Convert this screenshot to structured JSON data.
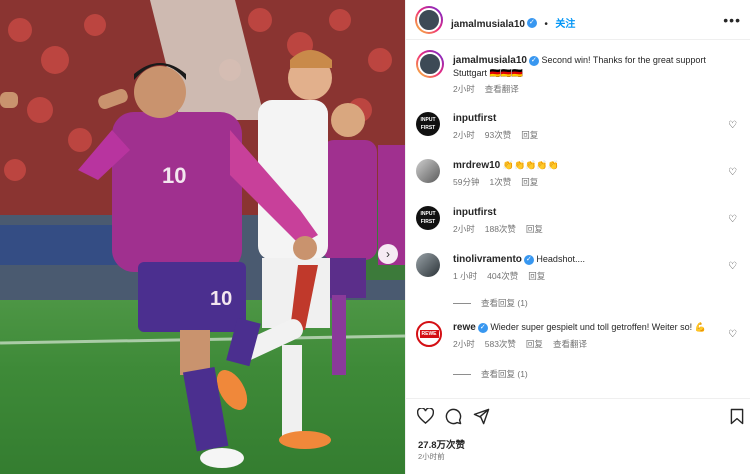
{
  "post": {
    "username": "jamalmusiala10",
    "follow_label": "关注",
    "more_label": "•••",
    "caption": "Second win! Thanks for the great support Stuttgart 🇩🇪🇩🇪🇩🇪",
    "caption_time": "2小时",
    "caption_translate": "查看翻译"
  },
  "comments": [
    {
      "username": "inputfirst",
      "verified": false,
      "text": "",
      "time": "2小时",
      "likes": "93次赞",
      "reply": "回复",
      "avatar": "INPUT FIRST"
    },
    {
      "username": "mrdrew10",
      "verified": false,
      "text": "👏👏👏👏👏",
      "time": "59分钟",
      "likes": "1次赞",
      "reply": "回复",
      "avatar": ""
    },
    {
      "username": "inputfirst",
      "verified": false,
      "text": "",
      "time": "2小时",
      "likes": "188次赞",
      "reply": "回复",
      "avatar": "INPUT FIRST"
    },
    {
      "username": "tinolivramento",
      "verified": true,
      "text": "Headshot....",
      "time": "1 小时",
      "likes": "404次赞",
      "reply": "回复",
      "avatar": ""
    },
    {
      "username": "rewe",
      "verified": true,
      "text": "Wieder super gespielt und toll getroffen! Weiter so! 💪",
      "time": "2小时",
      "likes": "583次赞",
      "reply": "回复",
      "translate": "查看翻译",
      "avatar": "REWE"
    }
  ],
  "view_replies": [
    "查看回复 (1)",
    "查看回复 (1)"
  ],
  "footer": {
    "likes": "27.8万次赞",
    "time": "2小时前"
  },
  "icons": {
    "like": "heart-icon",
    "comment": "comment-icon",
    "share": "share-icon",
    "save": "bookmark-icon",
    "next": "chevron-right-icon"
  },
  "colors": {
    "verified": "#3897f0",
    "follow": "#0095f6",
    "jersey": "#a0308f"
  }
}
